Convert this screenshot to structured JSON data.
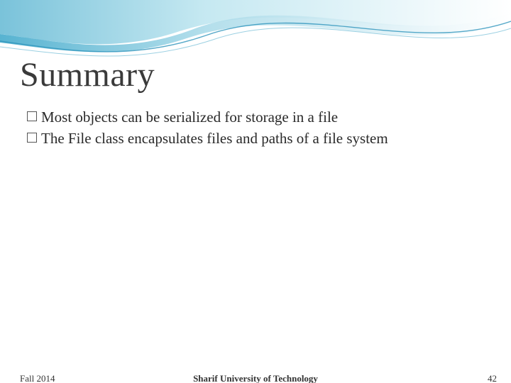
{
  "title": "Summary",
  "bullets": [
    "Most objects can be serialized for storage in a file",
    "The File class encapsulates files and paths of a file system"
  ],
  "footer": {
    "left": "Fall 2014",
    "center": "Sharif University of Technology",
    "right": "42"
  }
}
